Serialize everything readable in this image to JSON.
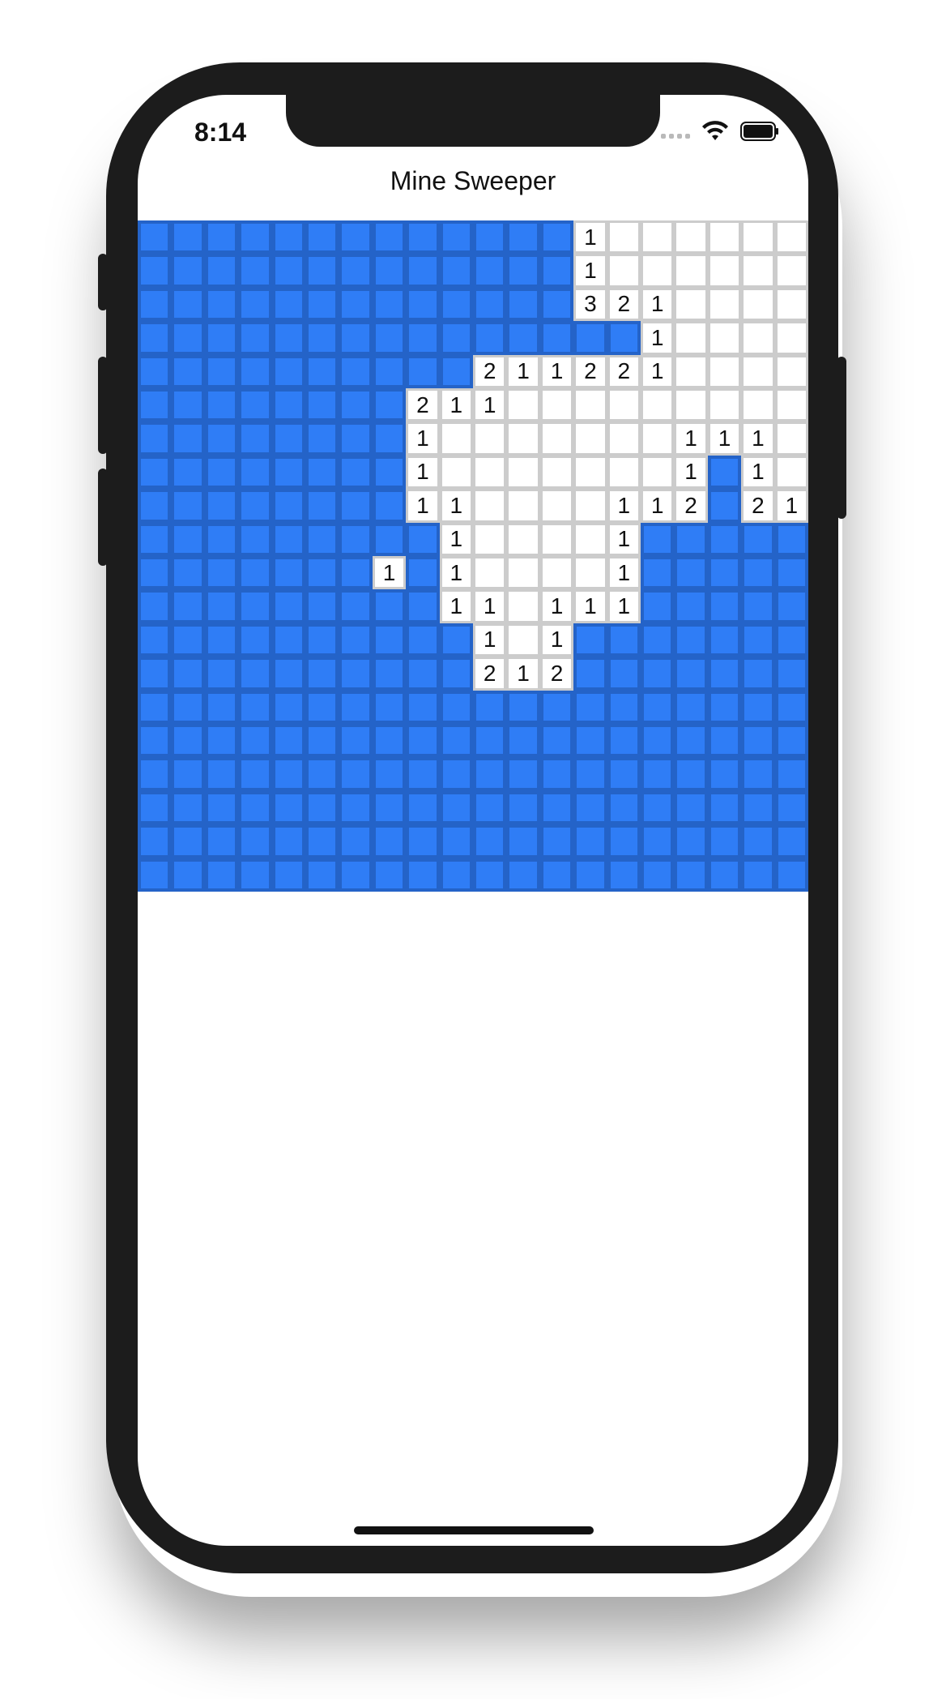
{
  "status_bar": {
    "time": "8:14"
  },
  "nav": {
    "title": "Mine Sweeper"
  },
  "colors": {
    "covered": "#2f7df6",
    "covered_border": "#2463c8",
    "open": "#ffffff",
    "open_border": "#cccccc"
  },
  "board": {
    "cols": 20,
    "legend": "C = covered tile, O = opened empty tile, digits = opened tile with adjacent mine count",
    "rows": [
      "CCCCCCCCCCCCC1OOOOOO",
      "CCCCCCCCCCCCC1OOOOOO",
      "CCCCCCCCCCCCC321OOOO",
      "CCCCCCCCCCCCCCC1OOOO",
      "CCCCCCCCCC211221OOOO",
      "CCCCCCCC211OOOOOOOOO",
      "CCCCCCCC1OOOOOOO111O",
      "CCCCCCCC1OOOOOOO1C1O",
      "CCCCCCCC11OOOO112C21",
      "CCCCCCCCC1OOOO1CCCCC",
      "CCCCCCC1C1OOOO1CCCCC",
      "CCCCCCCCC11O111CCCCC",
      "CCCCCCCCCC1O1CCCCCCC",
      "CCCCCCCCCC212CCCCCCC",
      "CCCCCCCCCCCCCCCCCCCC",
      "CCCCCCCCCCCCCCCCCCCC",
      "CCCCCCCCCCCCCCCCCCCC",
      "CCCCCCCCCCCCCCCCCCCC",
      "CCCCCCCCCCCCCCCCCCCC",
      "CCCCCCCCCCCCCCCCCCCC"
    ]
  }
}
